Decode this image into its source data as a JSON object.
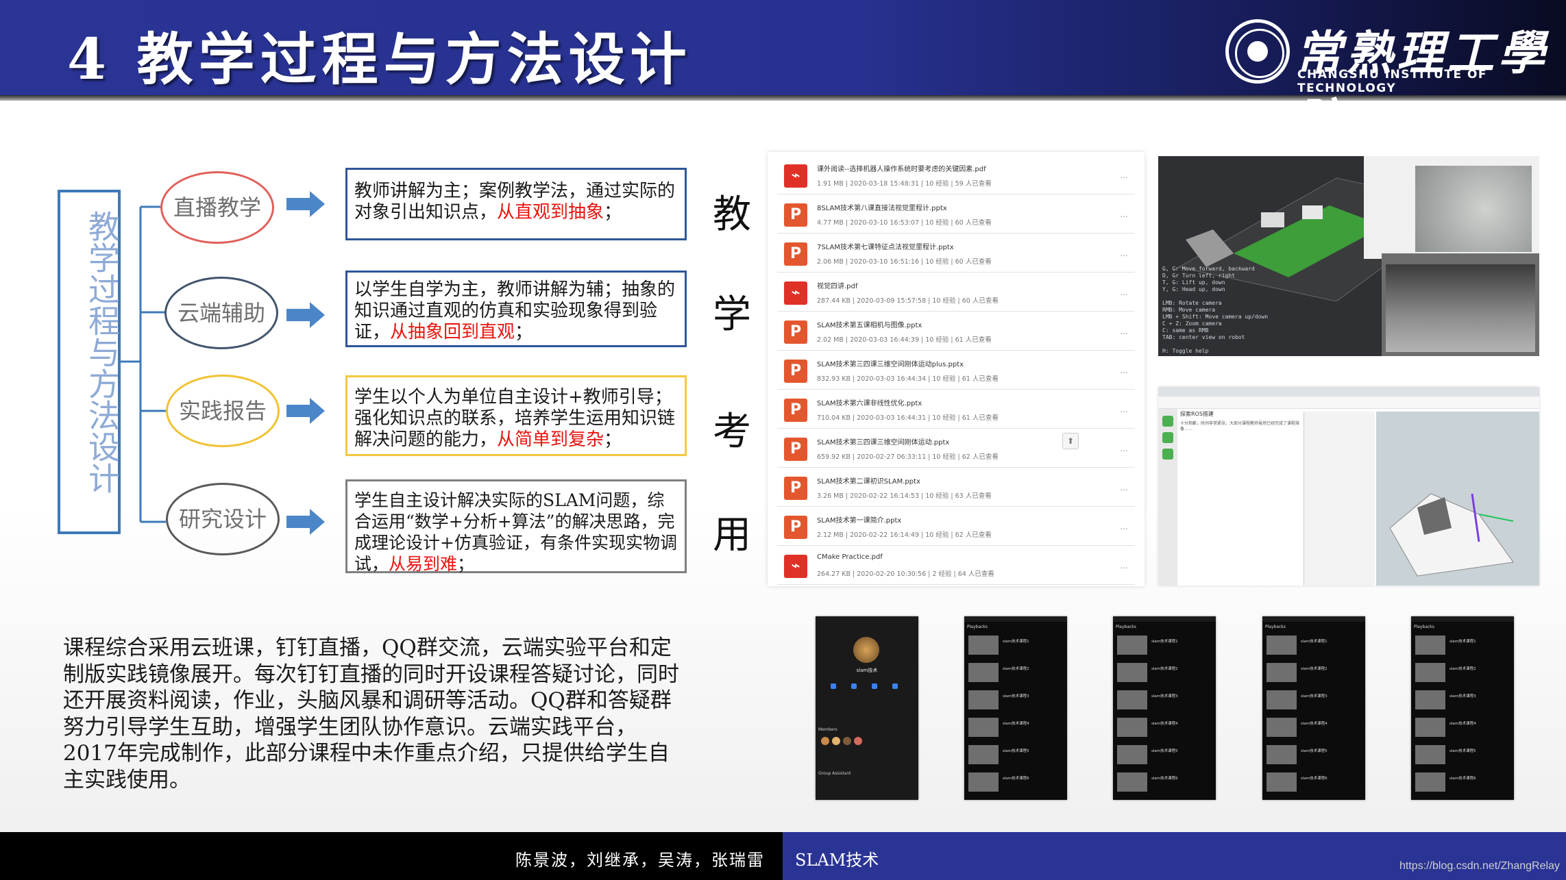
{
  "header": {
    "title": "4 教学过程与方法设计",
    "logo_cn": "常熟理工學院",
    "logo_en": "CHANGSHU INSTITUTE OF TECHNOLOGY"
  },
  "diagram": {
    "vertical_title": "教学过程与方法设计",
    "methods": [
      {
        "label": "直播教学",
        "color": "#e0605a"
      },
      {
        "label": "云端辅助",
        "color": "#41546c"
      },
      {
        "label": "实践报告",
        "color": "#f1c232"
      },
      {
        "label": "研究设计",
        "color": "#595959"
      }
    ],
    "descriptions": [
      {
        "text": "教师讲解为主；案例教学法，通过实际的对象引出知识点，",
        "highlight": "从直观到抽象",
        "tail": "；"
      },
      {
        "text": "以学生自学为主，教师讲解为辅；抽象的知识通过直观的仿真和实验现象得到验证，",
        "highlight": "从抽象回到直观",
        "tail": "；"
      },
      {
        "text": "学生以个人为单位自主设计+教师引导；强化知识点的联系，培养学生运用知识链解决问题的能力，",
        "highlight": "从简单到复杂",
        "tail": "；"
      },
      {
        "text": "学生自主设计解决实际的SLAM问题，综合运用“数学+分析+算法”的解决思路，完成理论设计+仿真验证，有条件实现实物调试，",
        "highlight": "从易到难",
        "tail": "；"
      }
    ],
    "arrow_color": "#4a86c8"
  },
  "vertical_label": [
    "教",
    "学",
    "考",
    "用"
  ],
  "file_list": [
    {
      "icon": "pdf",
      "name": "课外阅读--选择机器人操作系统时要考虑的关键因素.pdf",
      "meta": "1.91 MB  |  2020-03-18 15:48:31  |  10 经验  |  59 人已查看"
    },
    {
      "icon": "ppt",
      "name": "8SLAM技术第八课直接法视觉里程计.pptx",
      "meta": "4.77 MB  |  2020-03-10 16:53:07  |  10 经验  |  60 人已查看"
    },
    {
      "icon": "ppt",
      "name": "7SLAM技术第七课特征点法视觉里程计.pptx",
      "meta": "2.06 MB  |  2020-03-10 16:51:16  |  10 经验  |  60 人已查看"
    },
    {
      "icon": "pdf",
      "name": "视觉四讲.pdf",
      "meta": "287.44 KB  |  2020-03-09 15:57:58  |  10 经验  |  60 人已查看"
    },
    {
      "icon": "ppt",
      "name": "SLAM技术第五课相机与图像.pptx",
      "meta": "2.02 MB  |  2020-03-03 16:44:39  |  10 经验  |  61 人已查看"
    },
    {
      "icon": "ppt",
      "name": "SLAM技术第三四课三维空间刚体运动plus.pptx",
      "meta": "832.93 KB  |  2020-03-03 16:44:34  |  10 经验  |  61 人已查看"
    },
    {
      "icon": "ppt",
      "name": "SLAM技术第六课非线性优化.pptx",
      "meta": "710.04 KB  |  2020-03-03 16:44:31  |  10 经验  |  61 人已查看"
    },
    {
      "icon": "ppt",
      "name": "SLAM技术第三四课三维空间刚体运动.pptx",
      "meta": "659.92 KB  |  2020-02-27 06:33:11  |  10 经验  |  62 人已查看"
    },
    {
      "icon": "ppt",
      "name": "SLAM技术第二课初识SLAM.pptx",
      "meta": "3.26 MB  |  2020-02-22 16:14:53  |  10 经验  |  63 人已查看"
    },
    {
      "icon": "ppt",
      "name": "SLAM技术第一课简介.pptx",
      "meta": "2.12 MB  |  2020-02-22 16:14:49  |  10 经验  |  62 人已查看"
    },
    {
      "icon": "pdf",
      "name": "CMake Practice.pdf",
      "meta": "264.27 KB  |  2020-02-20 10:30:56  |  2 经验  |  64 人已查看"
    }
  ],
  "screens": {
    "sim_console": "G, Gr Move forward, backward\nD, Gr Turn left, right\nT, G: Lift up, down\nY, G: Head up, down\n\nLMB: Rotate camera\nRMB: Move camera\nLMB + Shift: Move camera up/down\nC + Z: Zoom camera\nC: same as RMB\nTAB: center view on robot\n\nH: Toggle help",
    "web_heading": "探索ROS搭建",
    "web_body": "十分抱歉，时间非常紧张，大部分课程教师虽然已经完成了课程准备……",
    "phone_1_name": "slam技术",
    "phone_1_sections": [
      "Members",
      "Group Assistant"
    ],
    "phone_tab_title": "Playbacks",
    "phone_rows": [
      "slam技术课程1",
      "slam技术课程2",
      "slam技术课程3",
      "slam技术课程4",
      "slam技术课程5",
      "slam技术课程6"
    ]
  },
  "paragraph": "课程综合采用云班课，钉钉直播，QQ群交流，云端实验平台和定制版实践镜像展开。每次钉钉直播的同时开设课程答疑讨论，同时还开展资料阅读，作业，头脑风暴和调研等活动。QQ群和答疑群努力引导学生互助，增强学生团队协作意识。云端实践平台，2017年完成制作，此部分课程中未作重点介绍，只提供给学生自主实践使用。",
  "footer": {
    "authors": "陈景波，刘继承，吴涛，张瑞雷",
    "topic": "SLAM技术",
    "url": "https://blog.csdn.net/ZhangRelay"
  }
}
